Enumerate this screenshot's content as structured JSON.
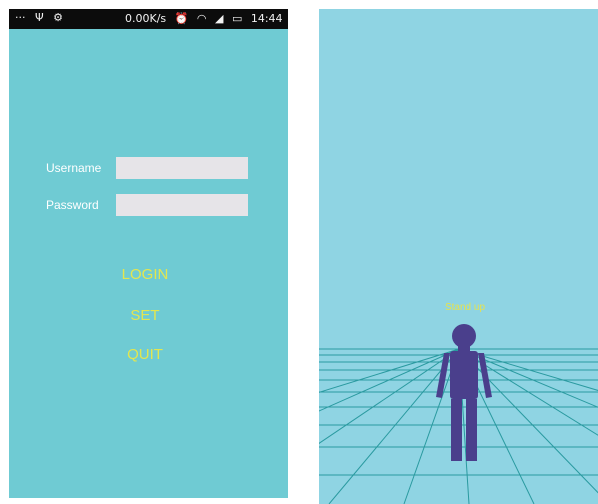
{
  "status_bar": {
    "icons_left": [
      "more-icon",
      "usb-icon",
      "android-debug-icon"
    ],
    "net_speed": "0.00K/s",
    "icons_right": [
      "alarm-icon",
      "wifi-icon",
      "signal-icon",
      "battery-icon"
    ],
    "time": "14:44"
  },
  "login_form": {
    "username_label": "Username",
    "username_value": "",
    "password_label": "Password",
    "password_value": ""
  },
  "menu": {
    "login": "LOGIN",
    "set": "SET",
    "quit": "QUIT"
  },
  "scene": {
    "pose_label": "Stand up"
  },
  "colors": {
    "left_bg": "#6fcbd3",
    "right_bg": "#8fd4e3",
    "accent_text": "#e3e64f",
    "figure": "#4a3f8c",
    "grid_line": "#2a9aa0"
  }
}
